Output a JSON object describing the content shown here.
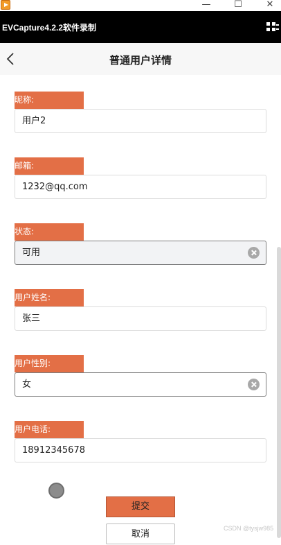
{
  "window": {
    "min_glyph": "—",
    "max_glyph": "☐",
    "close_glyph": "✕"
  },
  "capture_bar": {
    "title": "EVCapture4.2.2软件录制"
  },
  "header": {
    "title": "普通用户详情"
  },
  "form": {
    "fields": [
      {
        "label": "昵称:",
        "value": "用户2"
      },
      {
        "label": "邮箱:",
        "value": "1232@qq.com"
      },
      {
        "label": "状态:",
        "value": "可用"
      },
      {
        "label": "用户姓名:",
        "value": "张三"
      },
      {
        "label": "用户性别:",
        "value": "女"
      },
      {
        "label": "用户电话:",
        "value": "18912345678"
      }
    ]
  },
  "actions": {
    "submit_label": "提交",
    "cancel_label": "取消"
  },
  "watermark": "CSDN @tysjw985",
  "colors": {
    "accent": "#e36f46",
    "capture_bar": "#000000",
    "header_bg": "#f7f7f7"
  }
}
